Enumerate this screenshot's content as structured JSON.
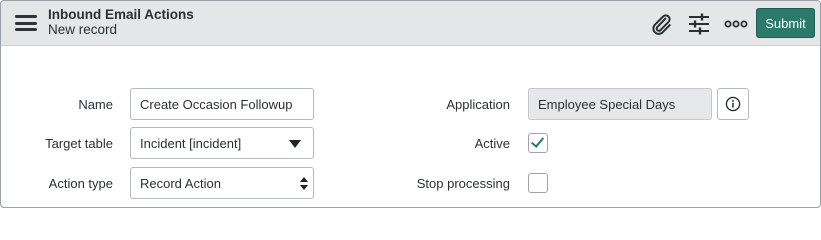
{
  "header": {
    "title": "Inbound Email Actions",
    "subtitle": "New record",
    "icons": [
      "menu-icon",
      "paperclip-icon",
      "sliders-icon",
      "more-icon"
    ],
    "submit_label": "Submit"
  },
  "form": {
    "name": {
      "label": "Name",
      "value": "Create Occasion Followup"
    },
    "target_table": {
      "label": "Target table",
      "value": "Incident [incident]"
    },
    "action_type": {
      "label": "Action type",
      "value": "Record Action"
    },
    "application": {
      "label": "Application",
      "value": "Employee Special Days"
    },
    "active": {
      "label": "Active",
      "checked": true
    },
    "stop_processing": {
      "label": "Stop processing",
      "checked": false
    }
  },
  "colors": {
    "accent": "#2b7a6b",
    "header_bg": "#e4e6e7",
    "readonly_bg": "#e6e7e8"
  }
}
